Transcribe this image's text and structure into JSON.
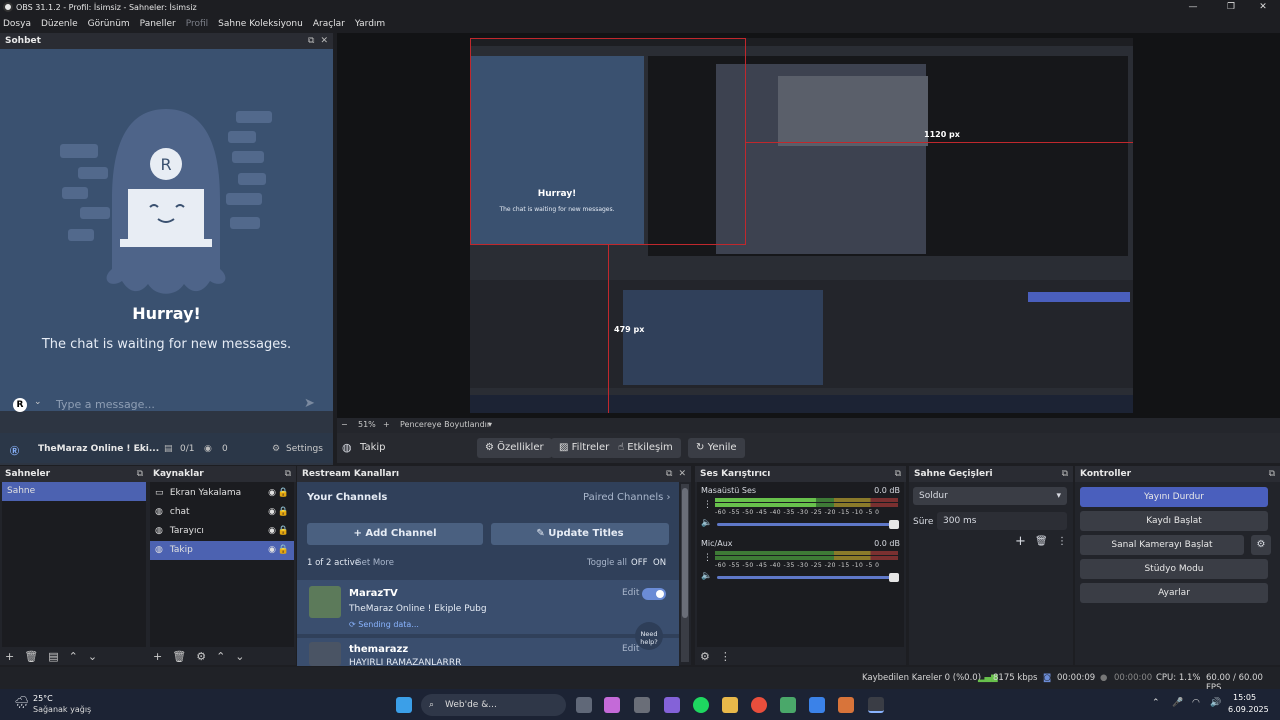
{
  "window": {
    "title": "OBS 31.1.2 - Profil: İsimsiz - Sahneler: İsimsiz"
  },
  "menu": [
    "Dosya",
    "Düzenle",
    "Görünüm",
    "Paneller",
    "Profil",
    "Sahne Koleksiyonu",
    "Araçlar",
    "Yardım"
  ],
  "chat": {
    "title": "Sohbet",
    "hurray": "Hurray!",
    "waiting": "The chat is waiting for new messages.",
    "input_placeholder": "Type a message...",
    "channel": "TheMaraz Online ! Eki...",
    "viewers": "0/1",
    "watchers": "0",
    "settings": "Settings"
  },
  "preview": {
    "inner_px_w": "1120 px",
    "inner_px_h": "479 px",
    "inner_hurray": "Hurray!",
    "inner_waiting": "The chat is waiting for new messages."
  },
  "zoombar": {
    "zoom": "51%",
    "fit": "Pencereye Boyutlandır"
  },
  "source_toolbar": {
    "source": "Takip",
    "properties": "Özellikler",
    "filters": "Filtreler",
    "interact": "Etkileşim",
    "refresh": "Yenile"
  },
  "scenes": {
    "title": "Sahneler",
    "items": [
      "Sahne"
    ]
  },
  "sources": {
    "title": "Kaynaklar",
    "items": [
      {
        "name": "Ekran Yakalama",
        "icon": "monitor-icon"
      },
      {
        "name": "chat",
        "icon": "globe-icon"
      },
      {
        "name": "Tarayıcı",
        "icon": "globe-icon"
      },
      {
        "name": "Takip",
        "icon": "globe-icon"
      }
    ]
  },
  "restream": {
    "title": "Restream Kanalları",
    "your_channels": "Your Channels",
    "paired_channels": "Paired Channels",
    "add_channel": "Add Channel",
    "update_titles": "Update Titles",
    "active_count": "1 of 2 active",
    "get_more": "Get More",
    "toggle_all": "Toggle all",
    "off": "OFF",
    "on": "ON",
    "channels": [
      {
        "name": "MarazTV",
        "title": "TheMaraz Online ! Ekiple Pubg",
        "status": "Sending data...",
        "edit": "Edit"
      },
      {
        "name": "themarazz",
        "title": "HAYIRLI RAMAZANLARRR",
        "edit": "Edit"
      }
    ],
    "need_help": "Need help?"
  },
  "mixer": {
    "title": "Ses Karıştırıcı",
    "tracks": [
      {
        "name": "Masaüstü Ses",
        "db": "0.0 dB",
        "level": 0.55
      },
      {
        "name": "Mic/Aux",
        "db": "0.0 dB",
        "level": 0.0
      }
    ],
    "scale": "-60 -55 -50 -45 -40 -35 -30 -25 -20 -15 -10 -5 0"
  },
  "transitions": {
    "title": "Sahne Geçişleri",
    "type": "Soldur",
    "duration_label": "Süre",
    "duration": "300 ms"
  },
  "controls": {
    "title": "Kontroller",
    "stop_stream": "Yayını Durdur",
    "start_record": "Kaydı Başlat",
    "virtual_cam": "Sanal Kamerayı Başlat",
    "studio_mode": "Stüdyo Modu",
    "settings": "Ayarlar"
  },
  "status": {
    "dropped": "Kaybedilen Kareler 0 (%0.0)",
    "bitrate": "8175 kbps",
    "stream_time": "00:00:09",
    "rec_time": "00:00:00",
    "cpu": "CPU: 1.1%",
    "fps": "60.00 / 60.00 FPS"
  },
  "taskbar": {
    "temp": "25°C",
    "weather": "Sağanak yağış",
    "search": "Web'de &...",
    "time": "15:05",
    "date": "6.09.2025"
  },
  "colors": {
    "accent": "#4a5fbd",
    "chat_bg": "#3a5170",
    "panel": "#22242a"
  }
}
